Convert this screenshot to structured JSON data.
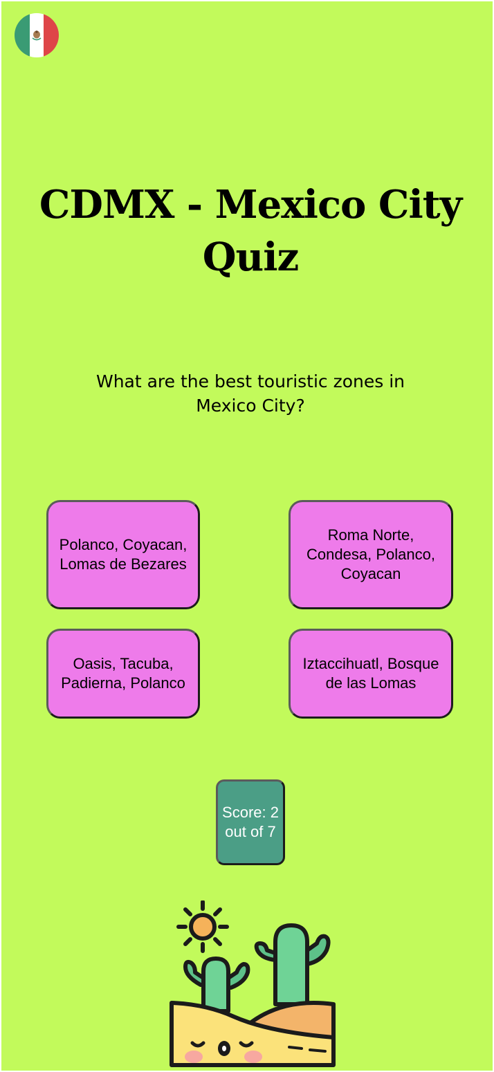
{
  "header": {
    "flag_icon": "mexico-flag-icon",
    "title": "CDMX - Mexico City Quiz"
  },
  "quiz": {
    "question": "What are the best touristic zones in Mexico City?",
    "answers": [
      "Polanco, Coyacan, Lomas de Bezares",
      "Roma Norte, Condesa, Polanco, Coyacan",
      "Oasis, Tacuba, Padierna, Polanco",
      "Iztaccihuatl, Bosque de las Lomas"
    ]
  },
  "score": {
    "text": "Score: 2 out of 7"
  },
  "illustration": {
    "icon": "cactus-desert-sun-illustration"
  },
  "colors": {
    "background": "#c2fa5b",
    "answer_button": "#ee7bea",
    "score_badge": "#4b9e86",
    "flag_green": "#3a9b74",
    "flag_red": "#de4548"
  }
}
